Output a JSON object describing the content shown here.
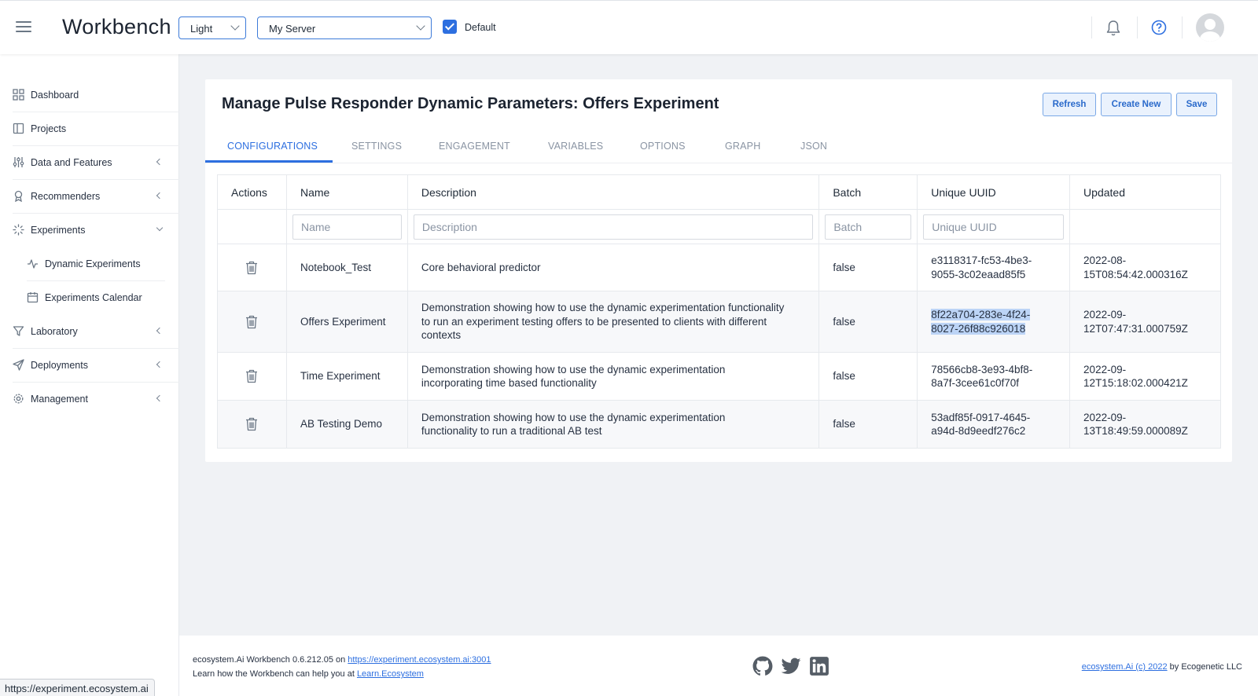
{
  "header": {
    "brand": "Workbench",
    "theme_select": "Light",
    "server_select": "My Server",
    "default_checked": true,
    "default_label": "Default"
  },
  "sidebar": {
    "items": [
      {
        "label": "Dashboard",
        "icon": "grid-icon"
      },
      {
        "label": "Projects",
        "icon": "book-icon"
      },
      {
        "label": "Data and Features",
        "icon": "sliders-icon",
        "expandable": true
      },
      {
        "label": "Recommenders",
        "icon": "award-icon",
        "expandable": true
      },
      {
        "label": "Experiments",
        "icon": "loader-icon",
        "expanded": true
      },
      {
        "label": "Dynamic Experiments",
        "icon": "activity-icon",
        "sub": true
      },
      {
        "label": "Experiments Calendar",
        "icon": "calendar-icon",
        "sub": true
      },
      {
        "label": "Laboratory",
        "icon": "filter-icon",
        "expandable": true
      },
      {
        "label": "Deployments",
        "icon": "send-icon",
        "expandable": true
      },
      {
        "label": "Management",
        "icon": "gear-icon",
        "expandable": true
      }
    ]
  },
  "page": {
    "title": "Manage Pulse Responder Dynamic Parameters: Offers Experiment",
    "buttons": {
      "refresh": "Refresh",
      "create": "Create New",
      "save": "Save"
    },
    "tabs": [
      "CONFIGURATIONS",
      "SETTINGS",
      "ENGAGEMENT",
      "VARIABLES",
      "OPTIONS",
      "GRAPH",
      "JSON"
    ],
    "active_tab": "CONFIGURATIONS"
  },
  "table": {
    "headers": [
      "Actions",
      "Name",
      "Description",
      "Batch",
      "Unique UUID",
      "Updated"
    ],
    "filters": {
      "name": "Name",
      "description": "Description",
      "batch": "Batch",
      "uuid": "Unique UUID"
    },
    "rows": [
      {
        "name": "Notebook_Test",
        "description": "Core behavioral predictor",
        "batch": "false",
        "uuid_1": "e3118317-fc53-4be3-",
        "uuid_2": "9055-3c02eaad85f5",
        "updated_1": "2022-08-",
        "updated_2": "15T08:54:42.000316Z"
      },
      {
        "name": "Offers Experiment",
        "description": "Demonstration showing how to use the dynamic experimentation functionality to run an experiment testing offers to be presented to clients with different contexts",
        "batch": "false",
        "uuid_1": "8f22a704-283e-4f24-",
        "uuid_2": "8027-26f88c926018",
        "updated_1": "2022-09-",
        "updated_2": "12T07:47:31.000759Z"
      },
      {
        "name": "Time Experiment",
        "description": "Demonstration showing how to use the dynamic experimentation incorporating time based functionality",
        "batch": "false",
        "uuid_1": "78566cb8-3e93-4bf8-",
        "uuid_2": "8a7f-3cee61c0f70f",
        "updated_1": "2022-09-",
        "updated_2": "12T15:18:02.000421Z"
      },
      {
        "name": "AB Testing Demo",
        "description": "Demonstration showing how to use the dynamic experimentation functionality to run a traditional AB test",
        "batch": "false",
        "uuid_1": "53adf85f-0917-4645-",
        "uuid_2": "a94d-8d9eedf276c2",
        "updated_1": "2022-09-",
        "updated_2": "13T18:49:59.000089Z"
      }
    ]
  },
  "footer": {
    "version_text": "ecosystem.Ai Workbench 0.6.212.05 on ",
    "version_link": "https://experiment.ecosystem.ai:3001",
    "learn_text": "Learn how the Workbench can help you at ",
    "learn_link": "Learn.Ecosystem",
    "copyright_link": "ecosystem.Ai (c) 2022",
    "copyright_suffix": " by Ecogenetic LLC",
    "social_icons": [
      "github-icon",
      "twitter-icon",
      "linkedin-icon"
    ]
  },
  "status_bar": {
    "url": "https://experiment.ecosystem.ai"
  },
  "colors": {
    "accent": "#2d6fe0",
    "background": "#f0f2f5",
    "selection": "#bcd4f6"
  }
}
